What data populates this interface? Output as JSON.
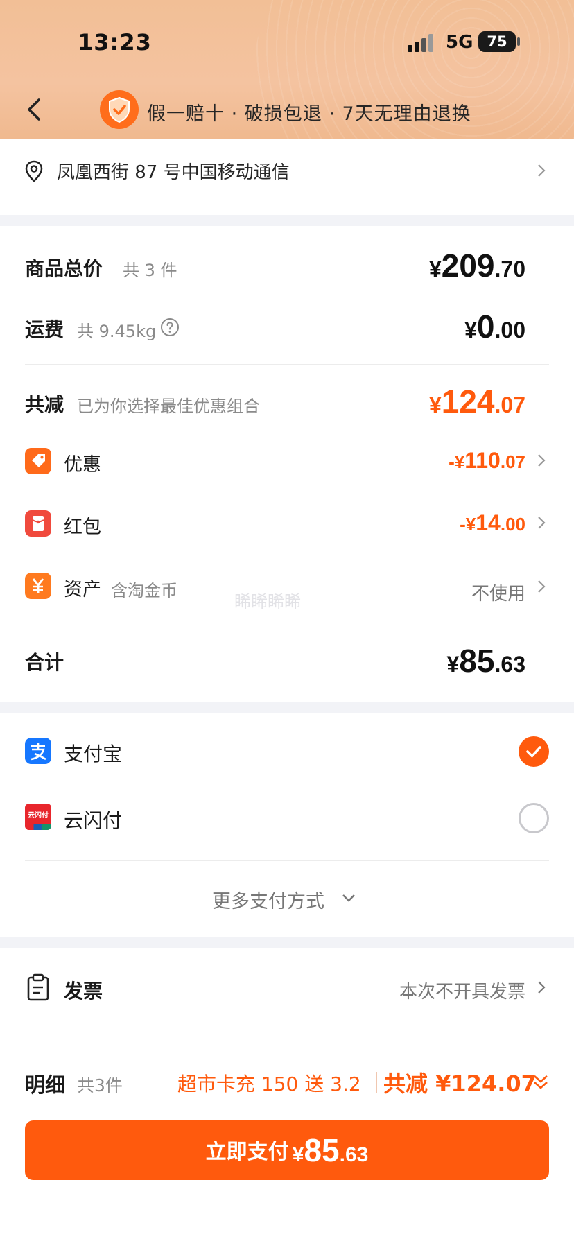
{
  "status_bar": {
    "time": "13:23",
    "network": "5G",
    "battery": "75"
  },
  "nav": {
    "title": "假一赔十 · 破损包退 · 7天无理由退换"
  },
  "address": {
    "text": "凤凰西街 87 号中国移动通信"
  },
  "summary": {
    "goods": {
      "label": "商品总价",
      "sub": "共 3 件",
      "symbol": "¥",
      "int": "209",
      "dec": ".70"
    },
    "shipping": {
      "label": "运费",
      "sub": "共 9.45kg",
      "symbol": "¥",
      "int": "0",
      "dec": ".00"
    },
    "discount": {
      "label": "共减",
      "sub": "已为你选择最佳优惠组合",
      "symbol": "¥",
      "int": "124",
      "dec": ".07"
    },
    "items": [
      {
        "label": "优惠",
        "symbol": "-¥",
        "int": "110",
        "dec": ".07"
      },
      {
        "label": "红包",
        "symbol": "-¥",
        "int": "14",
        "dec": ".00"
      },
      {
        "label": "资产",
        "sub": "含淘金币",
        "value": "不使用"
      }
    ],
    "watermark": "睎睎睎睎",
    "total": {
      "label": "合计",
      "symbol": "¥",
      "int": "85",
      "dec": ".63"
    }
  },
  "payment": {
    "methods": [
      {
        "name": "支付宝",
        "selected": true
      },
      {
        "name": "云闪付",
        "selected": false
      }
    ],
    "unionpay_icon_text": "云闪付",
    "more": "更多支付方式"
  },
  "invoice": {
    "label": "发票",
    "value": "本次不开具发票"
  },
  "detail": {
    "label": "明细",
    "count": "共3件",
    "promo": "超市卡充 150 送 3.2",
    "total": "共减 ¥124.07"
  },
  "pay_button": {
    "label": "立即支付",
    "symbol": "¥",
    "int": "85",
    "dec": ".63"
  },
  "colors": {
    "accent": "#ff5a0d",
    "header": "#f4c3a0",
    "alipay": "#1677ff",
    "red_packet": "#f04a3d"
  }
}
